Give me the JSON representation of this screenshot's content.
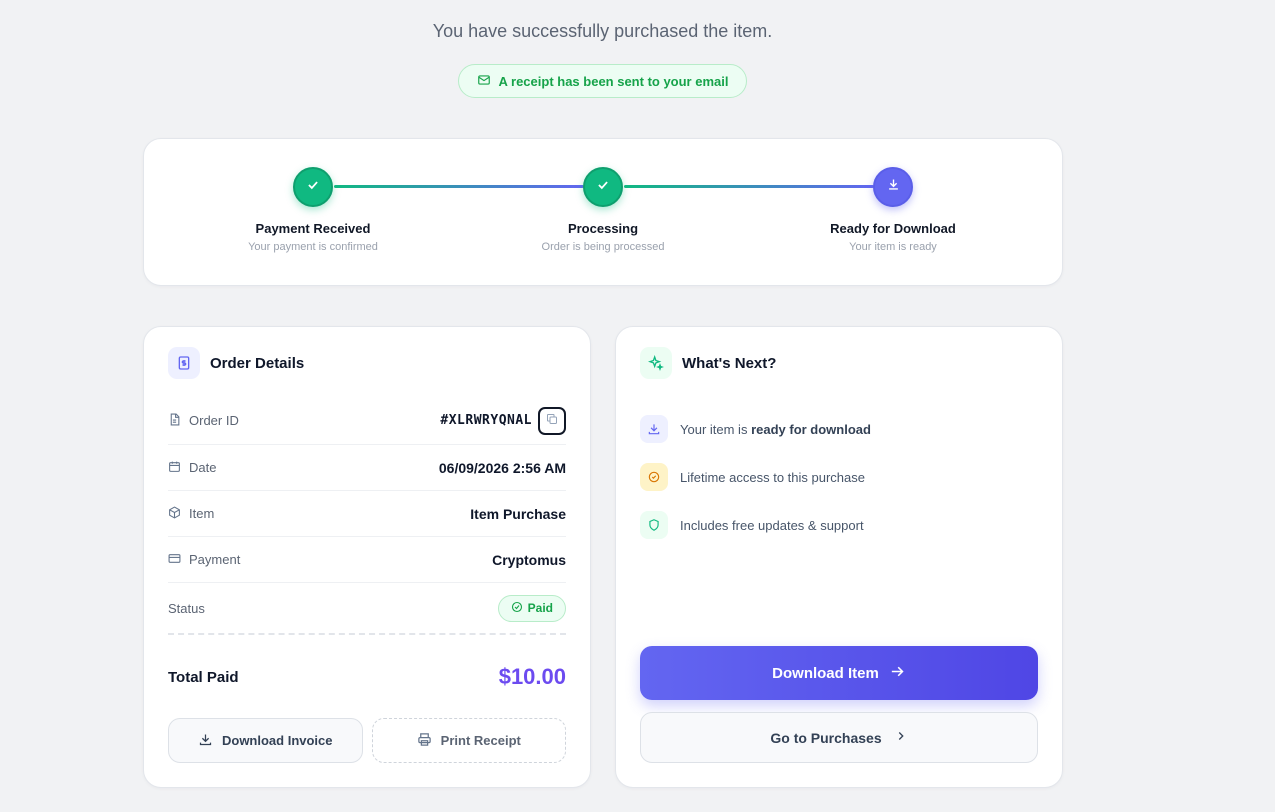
{
  "header": {
    "subtitle": "You have successfully purchased the item.",
    "receipt_notice": "A receipt has been sent to your email"
  },
  "progress": {
    "steps": [
      {
        "title": "Payment Received",
        "subtitle": "Your payment is confirmed",
        "state": "done",
        "icon": "check-icon"
      },
      {
        "title": "Processing",
        "subtitle": "Order is being processed",
        "state": "done",
        "icon": "check-icon"
      },
      {
        "title": "Ready for Download",
        "subtitle": "Your item is ready",
        "state": "active",
        "icon": "download-icon"
      }
    ]
  },
  "order": {
    "title": "Order Details",
    "rows": {
      "order_id": {
        "label": "Order ID",
        "value": "#XLRWRYQNAL"
      },
      "date": {
        "label": "Date",
        "value": "06/09/2026 2:56 AM"
      },
      "item": {
        "label": "Item",
        "value": "Item Purchase"
      },
      "payment": {
        "label": "Payment",
        "value": "Cryptomus"
      },
      "status": {
        "label": "Status",
        "value": "Paid"
      }
    },
    "total_label": "Total Paid",
    "total_value": "$10.00",
    "download_invoice": "Download Invoice",
    "print_receipt": "Print Receipt"
  },
  "next": {
    "title": "What's Next?",
    "items": [
      {
        "prefix": "Your item is ",
        "strong": "ready for download"
      },
      {
        "prefix": "Lifetime access to this purchase",
        "strong": ""
      },
      {
        "prefix": "Includes free updates & support",
        "strong": ""
      }
    ],
    "download_button": "Download Item",
    "purchases_button": "Go to Purchases"
  },
  "colors": {
    "accent": "#6366f1",
    "success": "#10b981",
    "background": "#f1f2f4"
  }
}
